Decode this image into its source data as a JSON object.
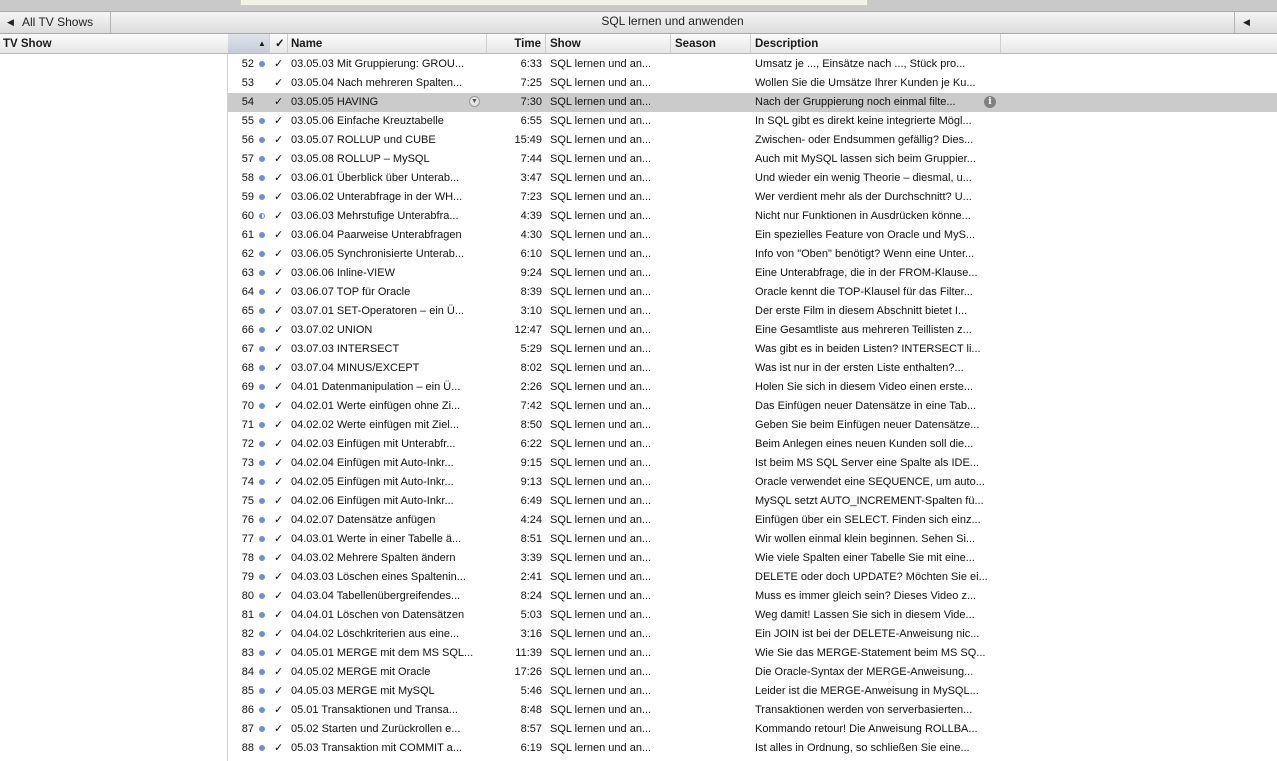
{
  "nav": {
    "back_label": "All TV Shows",
    "title": "SQL lernen und anwenden"
  },
  "columns": {
    "tv_show": "TV Show",
    "check": "✓",
    "name": "Name",
    "time": "Time",
    "show": "Show",
    "season": "Season",
    "description": "Description"
  },
  "rows": [
    {
      "num": "52",
      "name": "03.05.03 Mit Gruppierung: GROU...",
      "time": "6:33",
      "show": "SQL lernen und an...",
      "desc": "Umsatz je ..., Einsätze nach ..., Stück pro...",
      "played": "full"
    },
    {
      "num": "53",
      "name": "03.05.04 Nach mehreren Spalten...",
      "time": "7:25",
      "show": "SQL lernen und an...",
      "desc": "Wollen Sie die Umsätze Ihrer Kunden je Ku...",
      "played": "none"
    },
    {
      "num": "54",
      "name": "03.05.05 HAVING",
      "time": "7:30",
      "show": "SQL lernen und an...",
      "desc": "Nach der Gruppierung noch einmal filte...",
      "played": "none",
      "selected": true
    },
    {
      "num": "55",
      "name": "03.05.06 Einfache Kreuztabelle",
      "time": "6:55",
      "show": "SQL lernen und an...",
      "desc": "In SQL gibt es direkt keine integrierte Mögl...",
      "played": "full"
    },
    {
      "num": "56",
      "name": "03.05.07 ROLLUP und CUBE",
      "time": "15:49",
      "show": "SQL lernen und an...",
      "desc": "Zwischen- oder Endsummen gefällig? Dies...",
      "played": "full"
    },
    {
      "num": "57",
      "name": "03.05.08 ROLLUP – MySQL",
      "time": "7:44",
      "show": "SQL lernen und an...",
      "desc": "Auch mit MySQL lassen sich beim Gruppier...",
      "played": "full"
    },
    {
      "num": "58",
      "name": "03.06.01 Überblick über Unterab...",
      "time": "3:47",
      "show": "SQL lernen und an...",
      "desc": "Und wieder ein wenig Theorie – diesmal, u...",
      "played": "full"
    },
    {
      "num": "59",
      "name": "03.06.02 Unterabfrage in der WH...",
      "time": "7:23",
      "show": "SQL lernen und an...",
      "desc": "Wer verdient mehr als der Durchschnitt? U...",
      "played": "full"
    },
    {
      "num": "60",
      "name": "03.06.03 Mehrstufige Unterabfra...",
      "time": "4:39",
      "show": "SQL lernen und an...",
      "desc": "Nicht nur Funktionen in Ausdrücken könne...",
      "played": "half"
    },
    {
      "num": "61",
      "name": "03.06.04 Paarweise Unterabfragen",
      "time": "4:30",
      "show": "SQL lernen und an...",
      "desc": "Ein spezielles Feature von Oracle und MyS...",
      "played": "full"
    },
    {
      "num": "62",
      "name": "03.06.05 Synchronisierte Unterab...",
      "time": "6:10",
      "show": "SQL lernen und an...",
      "desc": "Info von \"Oben\" benötigt? Wenn eine Unter...",
      "played": "full"
    },
    {
      "num": "63",
      "name": "03.06.06 Inline-VIEW",
      "time": "9:24",
      "show": "SQL lernen und an...",
      "desc": "Eine Unterabfrage, die in der FROM-Klause...",
      "played": "full"
    },
    {
      "num": "64",
      "name": "03.06.07 TOP für Oracle",
      "time": "8:39",
      "show": "SQL lernen und an...",
      "desc": "Oracle kennt die TOP-Klausel für das Filter...",
      "played": "full"
    },
    {
      "num": "65",
      "name": "03.07.01 SET-Operatoren – ein Ü...",
      "time": "3:10",
      "show": "SQL lernen und an...",
      "desc": "Der erste Film in diesem Abschnitt bietet I...",
      "played": "full"
    },
    {
      "num": "66",
      "name": "03.07.02 UNION",
      "time": "12:47",
      "show": "SQL lernen und an...",
      "desc": "Eine Gesamtliste aus mehreren Teillisten z...",
      "played": "full"
    },
    {
      "num": "67",
      "name": "03.07.03 INTERSECT",
      "time": "5:29",
      "show": "SQL lernen und an...",
      "desc": "Was gibt es in beiden Listen? INTERSECT li...",
      "played": "full"
    },
    {
      "num": "68",
      "name": "03.07.04 MINUS/EXCEPT",
      "time": "8:02",
      "show": "SQL lernen und an...",
      "desc": "Was ist nur in der ersten Liste enthalten?...",
      "played": "full"
    },
    {
      "num": "69",
      "name": "04.01 Datenmanipulation – ein Ü...",
      "time": "2:26",
      "show": "SQL lernen und an...",
      "desc": "Holen Sie sich in diesem Video einen erste...",
      "played": "full"
    },
    {
      "num": "70",
      "name": "04.02.01 Werte einfügen ohne Zi...",
      "time": "7:42",
      "show": "SQL lernen und an...",
      "desc": "Das Einfügen neuer Datensätze in eine Tab...",
      "played": "full"
    },
    {
      "num": "71",
      "name": "04.02.02 Werte einfügen mit Ziel...",
      "time": "8:50",
      "show": "SQL lernen und an...",
      "desc": "Geben Sie beim Einfügen neuer Datensätze...",
      "played": "full"
    },
    {
      "num": "72",
      "name": "04.02.03 Einfügen mit Unterabfr...",
      "time": "6:22",
      "show": "SQL lernen und an...",
      "desc": "Beim Anlegen eines neuen Kunden soll die...",
      "played": "full"
    },
    {
      "num": "73",
      "name": "04.02.04 Einfügen mit Auto-Inkr...",
      "time": "9:15",
      "show": "SQL lernen und an...",
      "desc": "Ist beim MS SQL Server eine Spalte als IDE...",
      "played": "full"
    },
    {
      "num": "74",
      "name": "04.02.05 Einfügen mit Auto-Inkr...",
      "time": "9:13",
      "show": "SQL lernen und an...",
      "desc": "Oracle verwendet eine SEQUENCE, um auto...",
      "played": "full"
    },
    {
      "num": "75",
      "name": "04.02.06 Einfügen mit Auto-Inkr...",
      "time": "6:49",
      "show": "SQL lernen und an...",
      "desc": "MySQL setzt AUTO_INCREMENT-Spalten fü...",
      "played": "full"
    },
    {
      "num": "76",
      "name": "04.02.07 Datensätze anfügen",
      "time": "4:24",
      "show": "SQL lernen und an...",
      "desc": "Einfügen über ein SELECT. Finden sich einz...",
      "played": "full"
    },
    {
      "num": "77",
      "name": "04.03.01 Werte in einer Tabelle ä...",
      "time": "8:51",
      "show": "SQL lernen und an...",
      "desc": "Wir wollen einmal klein beginnen. Sehen Si...",
      "played": "full"
    },
    {
      "num": "78",
      "name": "04.03.02 Mehrere Spalten ändern",
      "time": "3:39",
      "show": "SQL lernen und an...",
      "desc": "Wie viele Spalten einer Tabelle Sie mit eine...",
      "played": "full"
    },
    {
      "num": "79",
      "name": "04.03.03 Löschen eines Spaltenin...",
      "time": "2:41",
      "show": "SQL lernen und an...",
      "desc": "DELETE oder doch UPDATE? Möchten Sie ei...",
      "played": "full"
    },
    {
      "num": "80",
      "name": "04.03.04 Tabellenübergreifendes...",
      "time": "8:24",
      "show": "SQL lernen und an...",
      "desc": "Muss es immer gleich sein? Dieses Video z...",
      "played": "full"
    },
    {
      "num": "81",
      "name": "04.04.01 Löschen von Datensätzen",
      "time": "5:03",
      "show": "SQL lernen und an...",
      "desc": "Weg damit! Lassen Sie sich in diesem Vide...",
      "played": "full"
    },
    {
      "num": "82",
      "name": "04.04.02 Löschkriterien aus eine...",
      "time": "3:16",
      "show": "SQL lernen und an...",
      "desc": "Ein JOIN ist bei der DELETE-Anweisung nic...",
      "played": "full"
    },
    {
      "num": "83",
      "name": "04.05.01 MERGE mit dem MS SQL...",
      "time": "11:39",
      "show": "SQL lernen und an...",
      "desc": "Wie Sie das MERGE-Statement beim MS SQ...",
      "played": "full"
    },
    {
      "num": "84",
      "name": "04.05.02 MERGE mit Oracle",
      "time": "17:26",
      "show": "SQL lernen und an...",
      "desc": "Die Oracle-Syntax der MERGE-Anweisung...",
      "played": "full"
    },
    {
      "num": "85",
      "name": "04.05.03 MERGE mit MySQL",
      "time": "5:46",
      "show": "SQL lernen und an...",
      "desc": "Leider ist die MERGE-Anweisung in MySQL...",
      "played": "full"
    },
    {
      "num": "86",
      "name": "05.01 Transaktionen und Transa...",
      "time": "8:48",
      "show": "SQL lernen und an...",
      "desc": "Transaktionen werden von serverbasierten...",
      "played": "full"
    },
    {
      "num": "87",
      "name": "05.02 Starten und Zurückrollen e...",
      "time": "8:57",
      "show": "SQL lernen und an...",
      "desc": "Kommando retour! Die Anweisung ROLLBA...",
      "played": "full"
    },
    {
      "num": "88",
      "name": "05.03 Transaktion mit COMMIT a...",
      "time": "6:19",
      "show": "SQL lernen und an...",
      "desc": "Ist alles in Ordnung, so schließen Sie eine...",
      "played": "full"
    }
  ],
  "colors": {
    "unplayed_dot": "#6f8fd3",
    "selection": "#cbcbcb"
  },
  "icons": {
    "back": "triangle-left",
    "forward": "triangle-left",
    "sort": "triangle-up",
    "info": "info-circle",
    "row_menu": "chevron-down-circle"
  }
}
